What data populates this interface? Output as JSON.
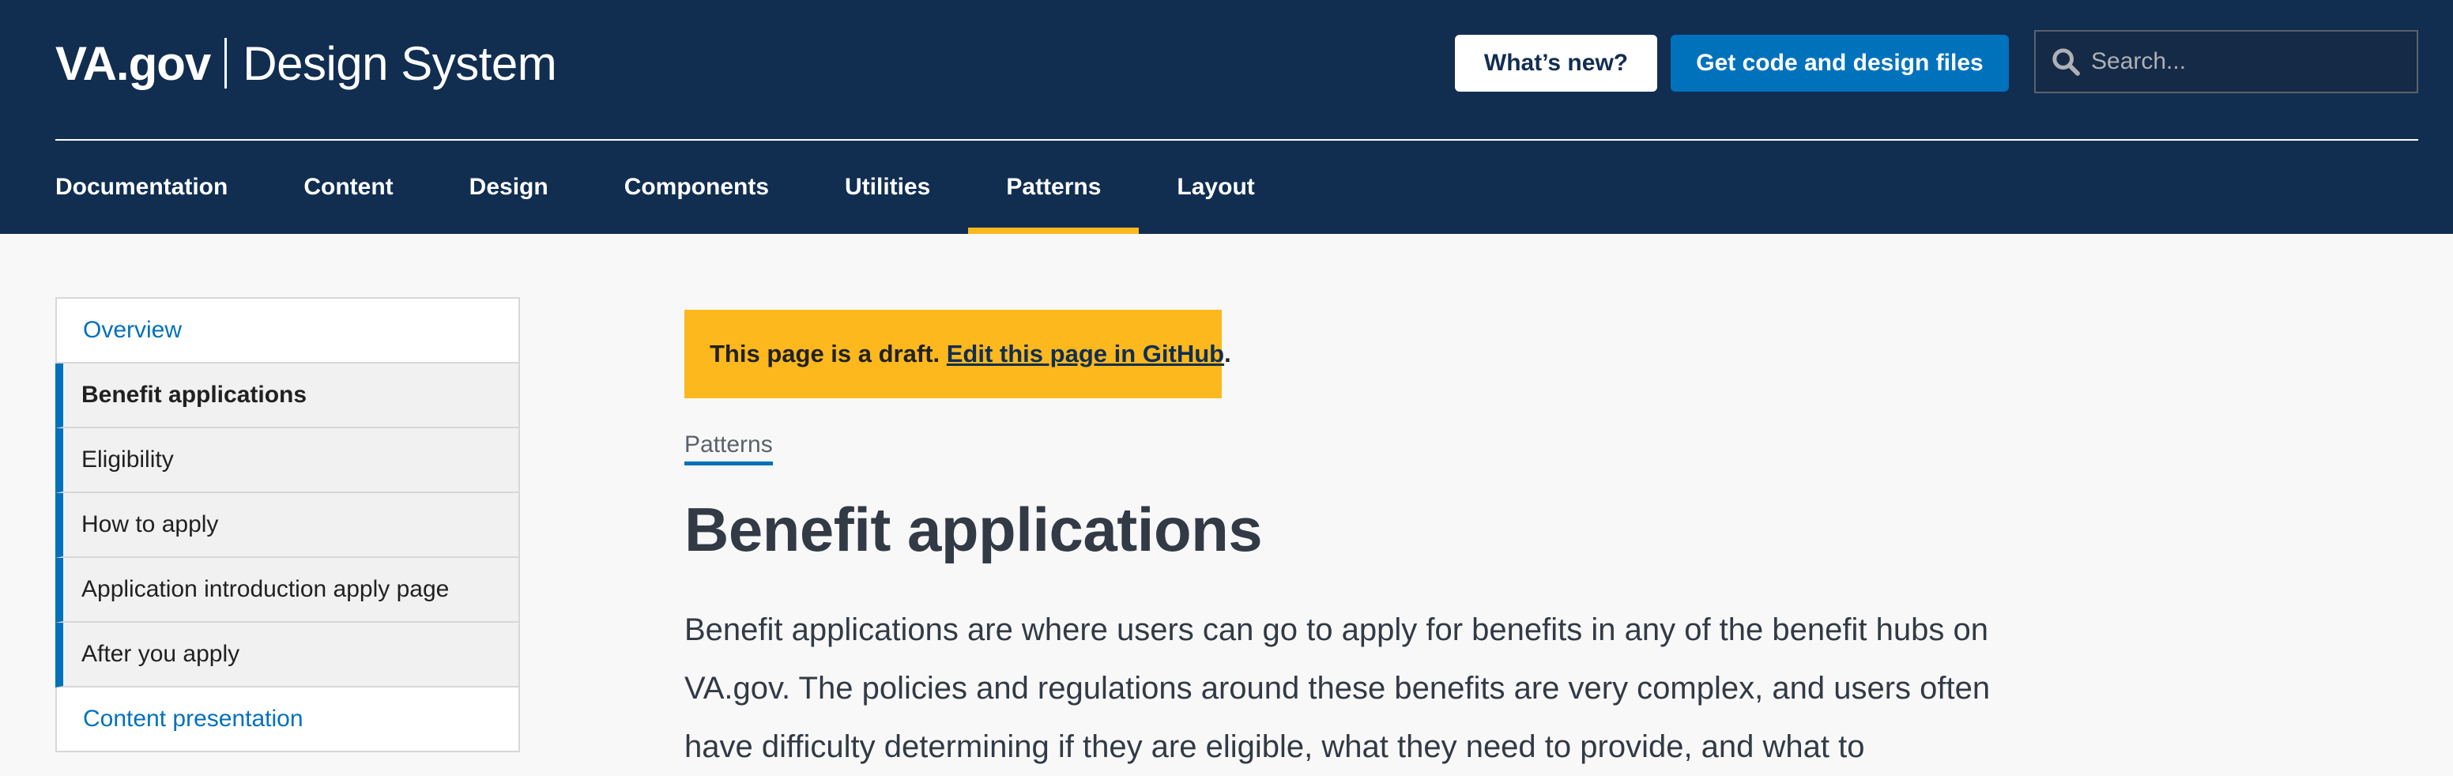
{
  "header": {
    "brand_va": "VA.gov",
    "brand_title": "Design System",
    "whats_new_label": "What’s new?",
    "get_code_label": "Get code and design files",
    "search_placeholder": "Search..."
  },
  "nav": {
    "items": [
      "Documentation",
      "Content",
      "Design",
      "Components",
      "Utilities",
      "Patterns",
      "Layout"
    ],
    "active": "Patterns"
  },
  "sidenav": {
    "overview": "Overview",
    "benefit_applications": "Benefit applications",
    "eligibility": "Eligibility",
    "how_to_apply": "How to apply",
    "application_intro": "Application introduction apply page",
    "after_you_apply": "After you apply",
    "content_presentation": "Content presentation"
  },
  "draft": {
    "text": "This page is a draft.",
    "link": "Edit this page in GitHub",
    "end": "."
  },
  "breadcrumb": "Patterns",
  "title": "Benefit applications",
  "lead": "Benefit applications are where users can go to apply for benefits in any of the benefit hubs on VA.gov. The policies and regulations around these benefits are very complex, and users often have difficulty determining if they are eligible, what they need to provide, and what to",
  "colors": {
    "header_bg": "#112e51",
    "primary": "#0071bb",
    "gold": "#fdb81e",
    "page_bg": "#f8f8f8"
  }
}
